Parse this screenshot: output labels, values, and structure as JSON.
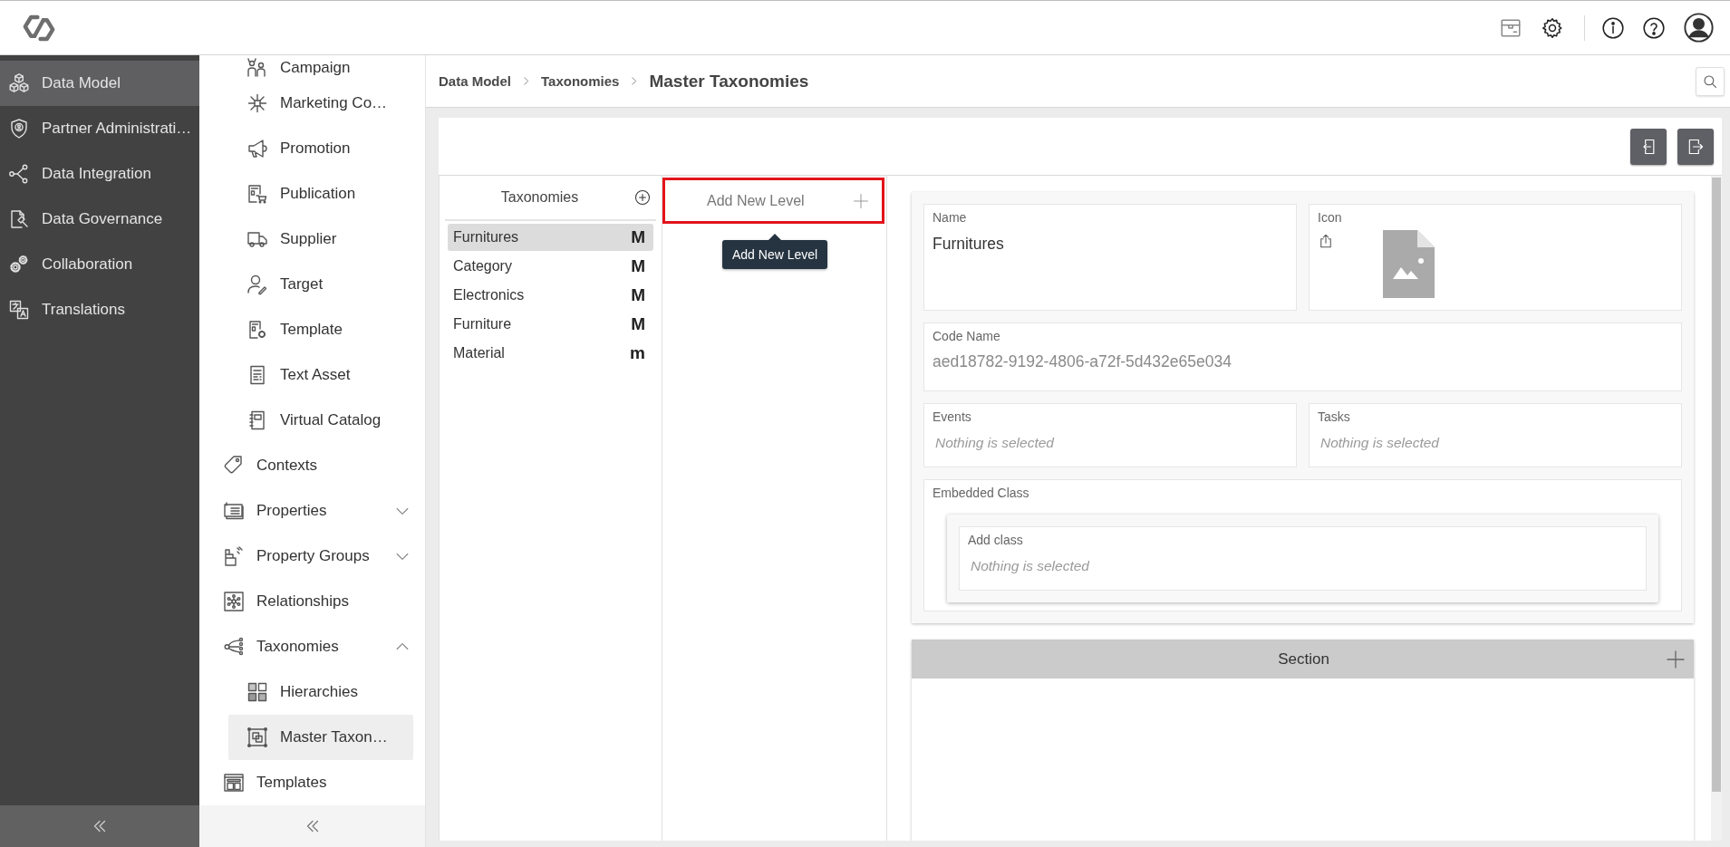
{
  "main_nav": {
    "items": [
      {
        "label": "Data Model",
        "selected": true
      },
      {
        "label": "Partner Administrati…",
        "selected": false
      },
      {
        "label": "Data Integration",
        "selected": false
      },
      {
        "label": "Data Governance",
        "selected": false
      },
      {
        "label": "Collaboration",
        "selected": false
      },
      {
        "label": "Translations",
        "selected": false
      }
    ]
  },
  "sub_nav": {
    "open_group_children": [
      {
        "label": "Campaign",
        "selected": false
      },
      {
        "label": "Marketing Co…",
        "selected": false
      },
      {
        "label": "Promotion",
        "selected": false
      },
      {
        "label": "Publication",
        "selected": false
      },
      {
        "label": "Supplier",
        "selected": false
      },
      {
        "label": "Target",
        "selected": false
      },
      {
        "label": "Template",
        "selected": false
      },
      {
        "label": "Text Asset",
        "selected": false
      },
      {
        "label": "Virtual Catalog",
        "selected": false
      }
    ],
    "items": [
      {
        "label": "Contexts",
        "kind": "link",
        "selected": false
      },
      {
        "label": "Properties",
        "kind": "group",
        "expanded": false,
        "selected": false
      },
      {
        "label": "Property Groups",
        "kind": "group",
        "expanded": false,
        "selected": false
      },
      {
        "label": "Relationships",
        "kind": "link",
        "selected": false
      },
      {
        "label": "Taxonomies",
        "kind": "group",
        "expanded": true,
        "selected": false,
        "children": [
          {
            "label": "Hierarchies",
            "selected": false
          },
          {
            "label": "Master Taxon…",
            "selected": true
          }
        ]
      },
      {
        "label": "Templates",
        "kind": "link",
        "selected": false
      }
    ]
  },
  "breadcrumb": {
    "links": [
      "Data Model",
      "Taxonomies"
    ],
    "current": "Master Taxonomies"
  },
  "taxonomies_panel": {
    "title": "Taxonomies",
    "items": [
      {
        "label": "Furnitures",
        "letter": "M",
        "selected": true
      },
      {
        "label": "Category",
        "letter": "M",
        "selected": false
      },
      {
        "label": "Electronics",
        "letter": "M",
        "selected": false
      },
      {
        "label": "Furniture",
        "letter": "M",
        "selected": false
      },
      {
        "label": "Material",
        "letter": "m",
        "selected": false
      }
    ]
  },
  "levels_panel": {
    "add_level": {
      "label": "Add New Level",
      "highlighted": true
    },
    "tooltip": "Add New Level"
  },
  "details": {
    "name": {
      "label": "Name",
      "value": "Furnitures"
    },
    "icon": {
      "label": "Icon"
    },
    "code_name": {
      "label": "Code Name",
      "value": "aed18782-9192-4806-a72f-5d432e65e034"
    },
    "events": {
      "label": "Events",
      "placeholder": "Nothing is selected"
    },
    "tasks": {
      "label": "Tasks",
      "placeholder": "Nothing is selected"
    },
    "embedded_class": {
      "label": "Embedded Class",
      "add_class": {
        "label": "Add class",
        "placeholder": "Nothing is selected"
      }
    }
  },
  "section": {
    "title": "Section"
  }
}
